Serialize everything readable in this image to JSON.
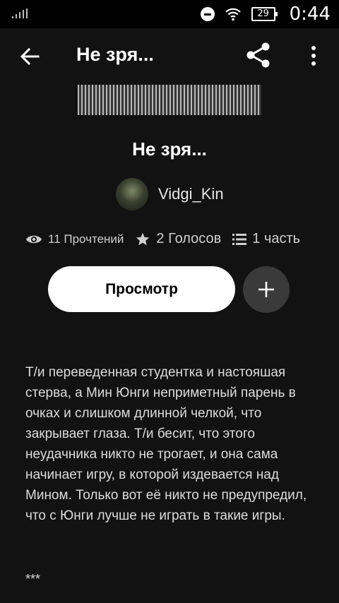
{
  "status_bar": {
    "time": "0:44",
    "battery": "29"
  },
  "app_bar": {
    "title": "Не зря..."
  },
  "story": {
    "title": "Не зря...",
    "author": "Vidgi_Kin",
    "reads": "11 Прочтений",
    "votes": "2 Голосов",
    "parts": "1 часть",
    "view_button": "Просмотр",
    "description": "Т/и переведенная студентка и настояшая стерва, а Мин Юнги неприметный парень в очках и слишком длинной челкой, что закрывает глаза. Т/и бесит, что этого неудачника никто не трогает, и она сама начинает игру, в которой издевается над Мином. Только вот её никто не предупредил, что с Юнги лучше не играть в такие игры.",
    "separator": "***"
  },
  "colors": {
    "background": "#121212",
    "status_bar": "#000000",
    "primary_button": "#ffffff",
    "secondary_button": "#3a3a3a"
  },
  "icons": [
    "signal-icon",
    "dnd-icon",
    "wifi-icon",
    "battery-icon",
    "back-arrow-icon",
    "share-icon",
    "more-vert-icon",
    "eye-icon",
    "star-icon",
    "list-icon",
    "plus-icon"
  ]
}
